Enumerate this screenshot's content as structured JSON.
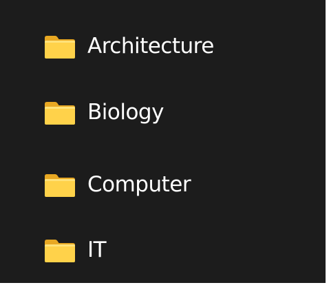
{
  "folder_list": {
    "items": [
      {
        "label": "Architecture",
        "icon": "folder-icon"
      },
      {
        "label": "Biology",
        "icon": "folder-icon"
      },
      {
        "label": "Computer",
        "icon": "folder-icon"
      },
      {
        "label": "IT",
        "icon": "folder-icon"
      }
    ]
  },
  "colors": {
    "background": "#1c1c1c",
    "text": "#ffffff",
    "folder_front": "#ffd24a",
    "folder_back": "#e8a823"
  }
}
